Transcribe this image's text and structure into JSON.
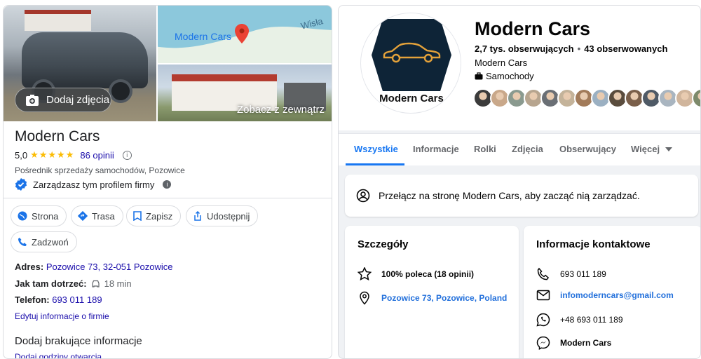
{
  "google": {
    "add_photo_label": "Dodaj zdjęcia",
    "map_label": "Modern Cars",
    "map_river_label": "Wisła",
    "outside_label": "Zobacz z zewnątrz",
    "title": "Modern Cars",
    "rating": "5,0",
    "stars": "★★★★★",
    "reviews": "86 opinii",
    "category": "Pośrednik sprzedaży samochodów, Pozowice",
    "managed_text": "Zarządzasz tym profilem firmy",
    "actions": [
      {
        "label": "Strona",
        "icon": "globe-icon"
      },
      {
        "label": "Trasa",
        "icon": "directions-icon"
      },
      {
        "label": "Zapisz",
        "icon": "bookmark-icon"
      },
      {
        "label": "Udostępnij",
        "icon": "share-icon"
      },
      {
        "label": "Zadzwoń",
        "icon": "phone-icon"
      }
    ],
    "address_label": "Adres:",
    "address_value": "Pozowice 73, 32-051 Pozowice",
    "directions_label": "Jak tam dotrzeć:",
    "directions_value": "18 min",
    "phone_label": "Telefon:",
    "phone_value": "693 011 189",
    "edit_info": "Edytuj informacje o firmie",
    "add_missing": "Dodaj brakujące informacje",
    "add_hours": "Dodaj godziny otwarcia"
  },
  "facebook": {
    "avatar_text": "Modern Cars",
    "title": "Modern Cars",
    "followers": "2,7 tys. obserwujących",
    "following": "43 obserwowanych",
    "subname": "Modern Cars",
    "category": "Samochody",
    "follower_avatar_colors": [
      "#3b3b3b",
      "#c9a88a",
      "#8a9a8f",
      "#b7a58f",
      "#6a6f75",
      "#c4b39a",
      "#a27b5a",
      "#9bb0c2",
      "#5a4c3d",
      "#7a5f4a",
      "#4f5a66",
      "#a9b5c0",
      "#d0b59c",
      "#7d8a6b"
    ],
    "tabs": [
      "Wszystkie",
      "Informacje",
      "Rolki",
      "Zdjęcia",
      "Obserwujący",
      "Więcej"
    ],
    "switch_text": "Przełącz na stronę Modern Cars, aby zacząć nią zarządzać.",
    "details_title": "Szczegóły",
    "details": [
      {
        "icon": "star-icon",
        "text": "100% poleca (18 opinii)"
      },
      {
        "icon": "location-pin-icon",
        "text": "Pozowice 73, Pozowice, Poland"
      }
    ],
    "contact_title": "Informacje kontaktowe",
    "contact": [
      {
        "icon": "phone-icon",
        "text": "693 011 189"
      },
      {
        "icon": "email-icon",
        "text": "infomoderncars@gmail.com"
      },
      {
        "icon": "whatsapp-icon",
        "text": "+48 693 011 189"
      },
      {
        "icon": "messenger-icon",
        "text": "Modern Cars"
      }
    ],
    "accent_color": "#1877f2"
  }
}
